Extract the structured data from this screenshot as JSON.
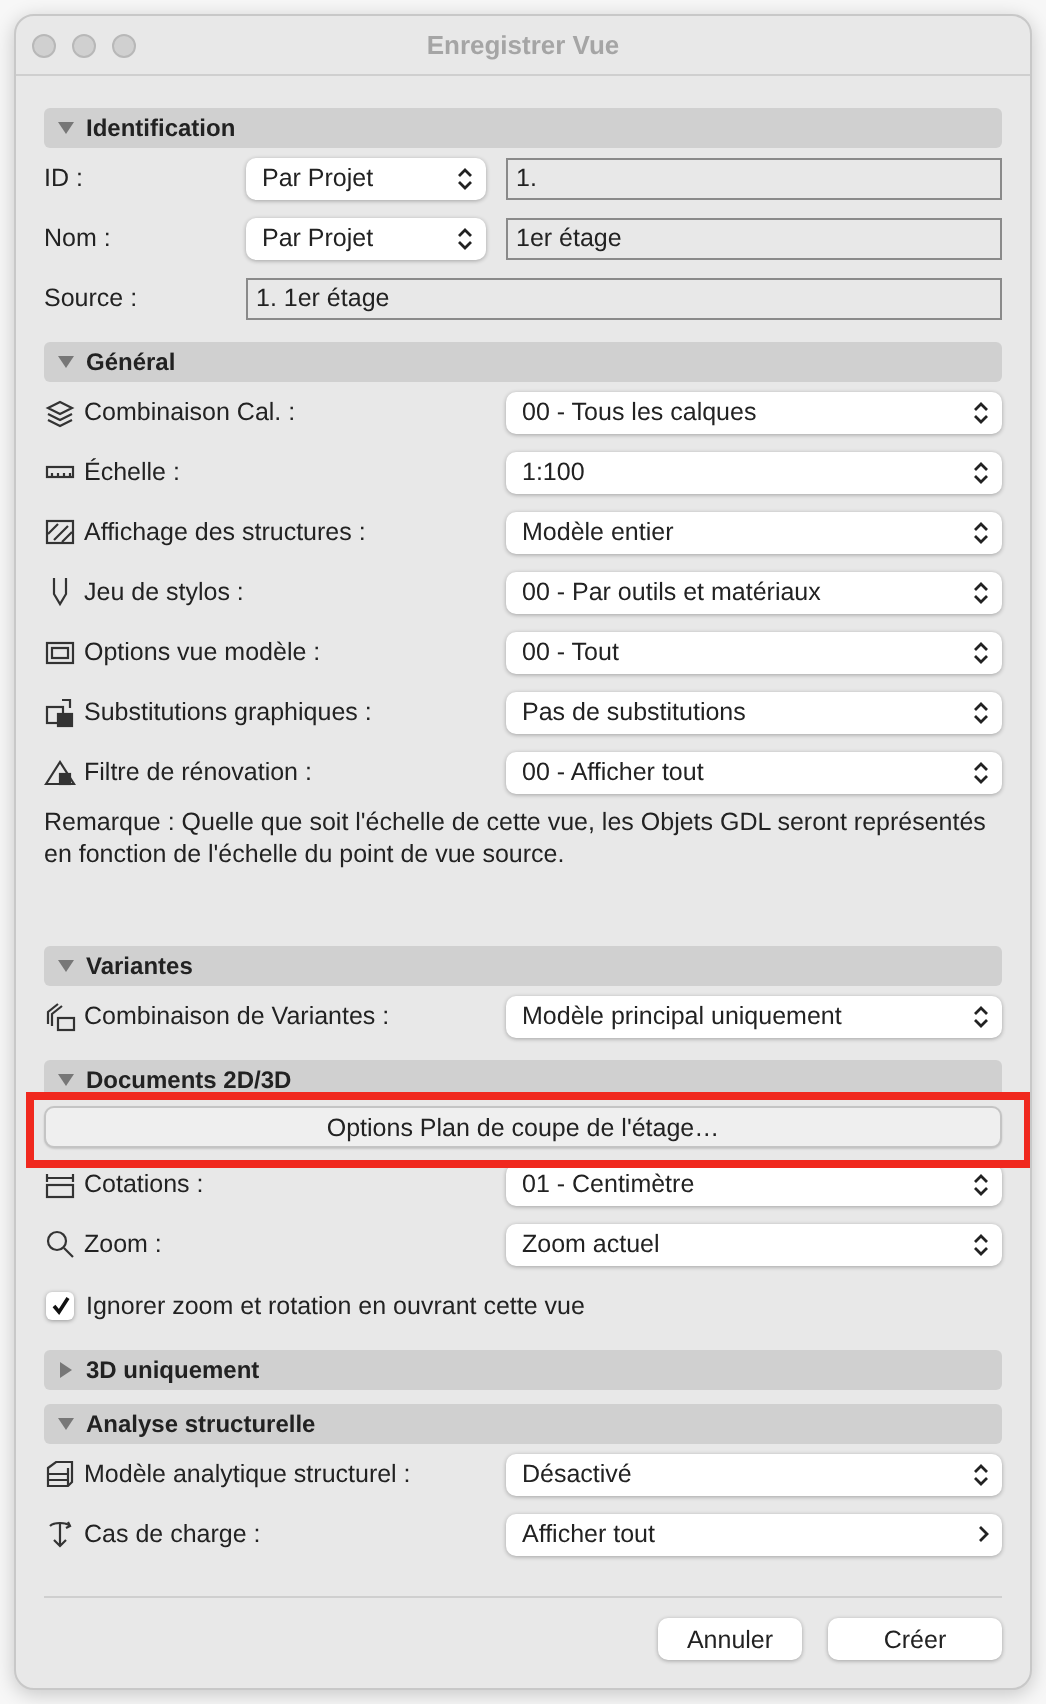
{
  "window": {
    "title": "Enregistrer Vue"
  },
  "sections": [
    {
      "title": "Identification",
      "expanded": true,
      "rows": [
        {
          "kind": "mode_field",
          "label": "ID :",
          "mode": "Par Projet",
          "value": "1."
        },
        {
          "kind": "mode_field",
          "label": "Nom :",
          "mode": "Par Projet",
          "value": "1er étage"
        },
        {
          "kind": "field",
          "label": "Source :",
          "value": "1. 1er étage"
        }
      ]
    },
    {
      "title": "Général",
      "expanded": true,
      "rows": [
        {
          "kind": "select",
          "label": "Combinaison Cal. :",
          "value": "00 - Tous les calques"
        },
        {
          "kind": "select",
          "label": "Échelle :",
          "value": "1:100"
        },
        {
          "kind": "select",
          "label": "Affichage des structures :",
          "value": "Modèle entier"
        },
        {
          "kind": "select",
          "label": "Jeu de stylos :",
          "value": "00 - Par outils et matériaux"
        },
        {
          "kind": "select",
          "label": "Options vue modèle :",
          "value": "00 - Tout"
        },
        {
          "kind": "select",
          "label": "Substitutions graphiques :",
          "value": "Pas de substitutions"
        },
        {
          "kind": "select",
          "label": "Filtre de rénovation :",
          "value": "00 - Afficher tout"
        }
      ],
      "note": "Remarque : Quelle que soit l'échelle de cette vue, les Objets GDL seront représentés en fonction de l'échelle du point de vue source."
    },
    {
      "title": "Variantes",
      "expanded": true,
      "rows": [
        {
          "kind": "select",
          "label": "Combinaison de Variantes :",
          "value": "Modèle principal uniquement"
        }
      ]
    },
    {
      "title": "Documents 2D/3D",
      "expanded": true,
      "rows": [
        {
          "kind": "button",
          "label": "Options Plan de coupe de l'étage…",
          "highlighted": true
        },
        {
          "kind": "select",
          "label": "Cotations :",
          "value": "01 - Centimètre"
        },
        {
          "kind": "select",
          "label": "Zoom :",
          "value": "Zoom actuel"
        },
        {
          "kind": "checkbox",
          "label": "Ignorer zoom et rotation en ouvrant cette vue",
          "checked": true
        }
      ]
    },
    {
      "title": "3D uniquement",
      "expanded": false
    },
    {
      "title": "Analyse structurelle",
      "expanded": true,
      "rows": [
        {
          "kind": "select",
          "label": "Modèle analytique structurel :",
          "value": "Désactivé"
        },
        {
          "kind": "disclosure",
          "label": "Cas de charge :",
          "value": "Afficher tout"
        }
      ]
    }
  ],
  "buttons": [
    {
      "label": "Annuler"
    },
    {
      "label": "Créer"
    }
  ]
}
